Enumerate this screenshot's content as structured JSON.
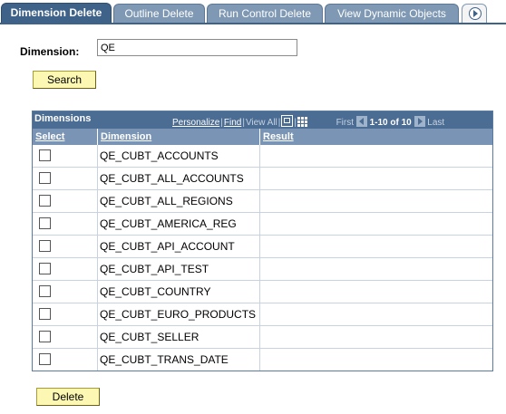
{
  "tabs": [
    {
      "label": "Dimension Delete"
    },
    {
      "label": "Outline Delete"
    },
    {
      "label": "Run Control Delete"
    },
    {
      "label": "View Dynamic Objects"
    }
  ],
  "form": {
    "dimension_label": "Dimension:",
    "dimension_value": "QE",
    "search_label": "Search",
    "delete_label": "Delete"
  },
  "grid": {
    "title": "Dimensions",
    "personalize": "Personalize",
    "find": "Find",
    "view_all": "View All",
    "first": "First",
    "range": "1-10 of 10",
    "last": "Last",
    "columns": [
      "Select",
      "Dimension",
      "Result"
    ],
    "rows": [
      {
        "dimension": "QE_CUBT_ACCOUNTS",
        "result": ""
      },
      {
        "dimension": "QE_CUBT_ALL_ACCOUNTS",
        "result": ""
      },
      {
        "dimension": "QE_CUBT_ALL_REGIONS",
        "result": ""
      },
      {
        "dimension": "QE_CUBT_AMERICA_REG",
        "result": ""
      },
      {
        "dimension": "QE_CUBT_API_ACCOUNT",
        "result": ""
      },
      {
        "dimension": "QE_CUBT_API_TEST",
        "result": ""
      },
      {
        "dimension": "QE_CUBT_COUNTRY",
        "result": ""
      },
      {
        "dimension": "QE_CUBT_EURO_PRODUCTS",
        "result": ""
      },
      {
        "dimension": "QE_CUBT_SELLER",
        "result": ""
      },
      {
        "dimension": "QE_CUBT_TRANS_DATE",
        "result": ""
      }
    ]
  },
  "colors": {
    "tab_active": "#3f6289",
    "tab_inactive": "#7f98b3",
    "grid_header": "#4b6c93",
    "column_header": "#7994b4",
    "button": "#fcf7b3"
  },
  "icons": {
    "tab_scroll": "arrow-right-circle-icon",
    "zoom": "zoom-icon",
    "download": "grid-download-icon",
    "prev": "previous-arrow-icon",
    "next": "next-arrow-icon"
  }
}
